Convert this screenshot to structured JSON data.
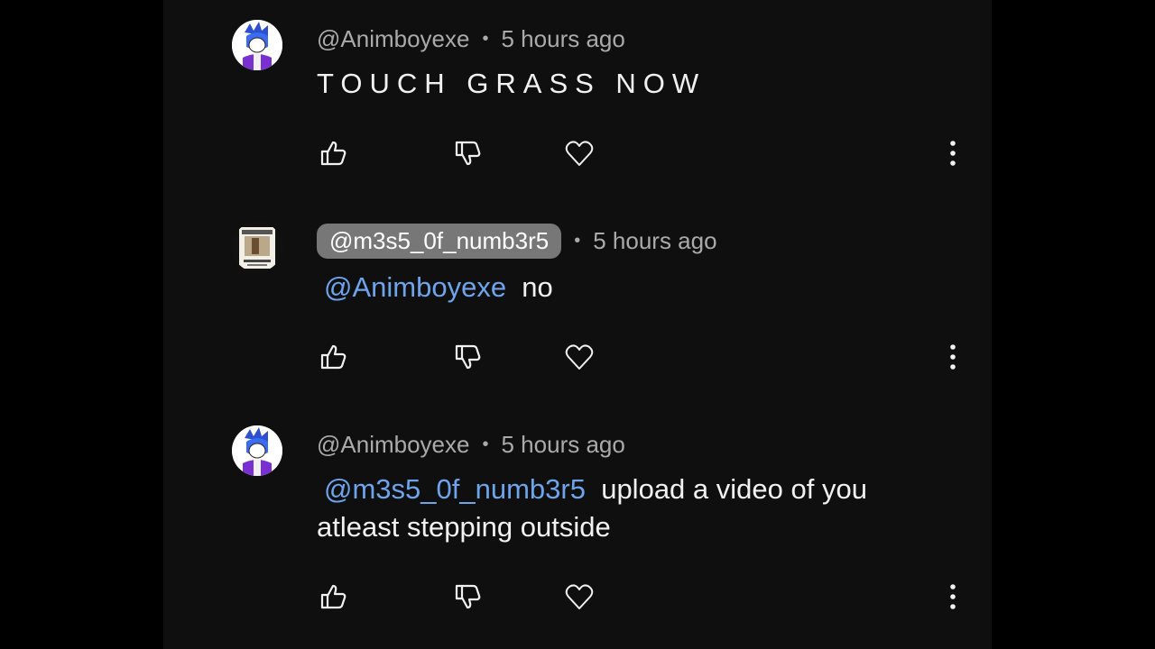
{
  "comments": [
    {
      "author": "@Animboyexe",
      "time": "5 hours ago",
      "mention": "",
      "text": "TOUCH GRASS NOW",
      "highlighted": false
    },
    {
      "author": "@m3s5_0f_numb3r5",
      "time": "5 hours ago",
      "mention": "@Animboyexe",
      "text": "no",
      "highlighted": true
    },
    {
      "author": "@Animboyexe",
      "time": "5 hours ago",
      "mention": "@m3s5_0f_numb3r5",
      "text": "upload a video of you atleast stepping outside",
      "highlighted": false
    }
  ],
  "separator": "•",
  "icons": [
    "thumbs-up-icon",
    "thumbs-down-icon",
    "heart-icon",
    "more-vert-icon"
  ],
  "colors": {
    "background": "#0f0f0f",
    "mention": "#6ea4ec",
    "meta": "#aaaaaa",
    "pill": "#777777"
  }
}
